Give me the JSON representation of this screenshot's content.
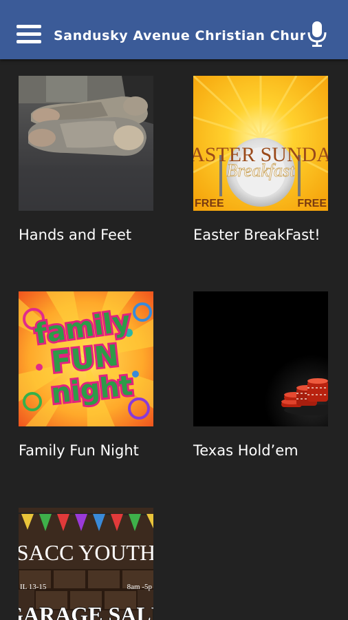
{
  "appbar": {
    "title": "Sandusky Avenue Christian Chur",
    "menu_icon": "hamburger-menu-icon",
    "mic_icon": "microphone-icon",
    "color": "#3b5b98"
  },
  "background_color": "#222222",
  "items": [
    {
      "label": "Hands and Feet"
    },
    {
      "label": "Easter BreakFast!",
      "image_text": {
        "line1": "ASTER SUNDA",
        "line2": "Breakfast",
        "free_left": "FREE",
        "free_right": "FREE"
      }
    },
    {
      "label": "Family Fun Night",
      "image_text": {
        "line1": "family",
        "line2": "FUN",
        "line3": "night"
      }
    },
    {
      "label": "Texas Hold’em"
    },
    {
      "label": "SACC YOUTH Garage Sale",
      "image_text": {
        "line1": "SACC YOUTH",
        "date_left": "IL 13-15",
        "date_right": "8am -5p",
        "line2": "GARAGE SALE"
      }
    }
  ]
}
